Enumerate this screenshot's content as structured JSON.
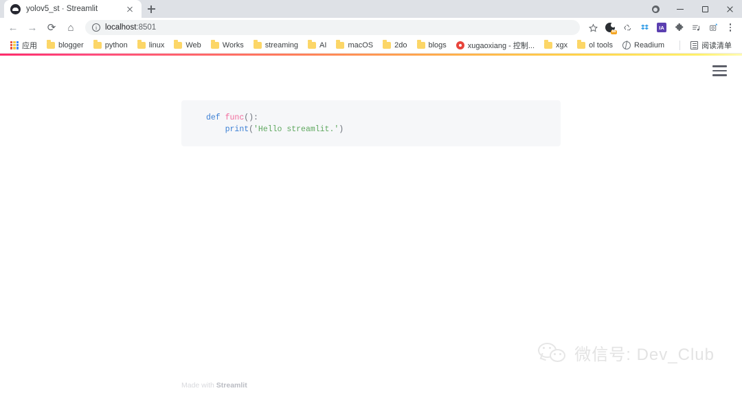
{
  "browser": {
    "tab": {
      "title": "yolov5_st · Streamlit",
      "favicon": "streamlit-favicon-icon",
      "close": "close-icon"
    },
    "new_tab_label": "+",
    "window_controls": {
      "profile": "profile-icon",
      "minimize": "minimize-icon",
      "maximize": "maximize-icon",
      "close": "close-icon"
    },
    "nav": {
      "back": "←",
      "forward": "→",
      "reload": "⟳",
      "home": "⌂"
    },
    "omnibox": {
      "security_icon": "info-circle-icon",
      "host": "localhost",
      "port": ":8501",
      "full_url": "localhost:8501"
    },
    "toolbar_icons": [
      {
        "name": "bookmark-star-icon",
        "glyph": "☆"
      },
      {
        "name": "extension-badge-icon",
        "badge": "86"
      },
      {
        "name": "recycle-icon",
        "glyph": "♻"
      },
      {
        "name": "dropbox-icon",
        "glyph": "◈"
      },
      {
        "name": "internet-archive-icon",
        "label": "IA"
      },
      {
        "name": "puzzle-extensions-icon",
        "glyph": "🧩"
      },
      {
        "name": "playlist-icon",
        "glyph": "☰♪"
      },
      {
        "name": "screenshot-icon",
        "glyph": "◰"
      },
      {
        "name": "chrome-menu-icon",
        "glyph": "⋮"
      }
    ],
    "bookmarks": [
      {
        "label": "应用",
        "icon": "apps-grid-icon"
      },
      {
        "label": "blogger",
        "icon": "folder-icon"
      },
      {
        "label": "python",
        "icon": "folder-icon"
      },
      {
        "label": "linux",
        "icon": "folder-icon"
      },
      {
        "label": "Web",
        "icon": "folder-icon"
      },
      {
        "label": "Works",
        "icon": "folder-icon"
      },
      {
        "label": "streaming",
        "icon": "folder-icon"
      },
      {
        "label": "AI",
        "icon": "folder-icon"
      },
      {
        "label": "macOS",
        "icon": "folder-icon"
      },
      {
        "label": "2do",
        "icon": "folder-icon"
      },
      {
        "label": "blogs",
        "icon": "folder-icon"
      },
      {
        "label": "xugaoxiang - 控制...",
        "icon": "wordpress-icon"
      },
      {
        "label": "xgx",
        "icon": "folder-icon"
      },
      {
        "label": "ol tools",
        "icon": "folder-icon"
      },
      {
        "label": "Readium",
        "icon": "globe-icon"
      }
    ],
    "reading_list": {
      "label": "阅读清单",
      "icon": "reading-list-icon"
    }
  },
  "app": {
    "menu_icon": "hamburger-menu-icon",
    "accent_gradient": [
      "#ff2b6b",
      "#ffa94d",
      "#fff06a"
    ],
    "code": {
      "language": "python",
      "background": "#f6f7f9",
      "line1": {
        "kw": "def",
        "space": " ",
        "fn": "func",
        "punct": "():"
      },
      "line2": {
        "indent": "    ",
        "fn": "print",
        "open": "(",
        "string": "'Hello streamlit.'",
        "close": ")"
      },
      "raw": "def func():\n    print('Hello streamlit.')"
    },
    "footer": {
      "prefix": "Made with ",
      "brand": "Streamlit"
    },
    "watermark": {
      "icon": "wechat-icon",
      "text": "微信号: Dev_Club"
    }
  }
}
